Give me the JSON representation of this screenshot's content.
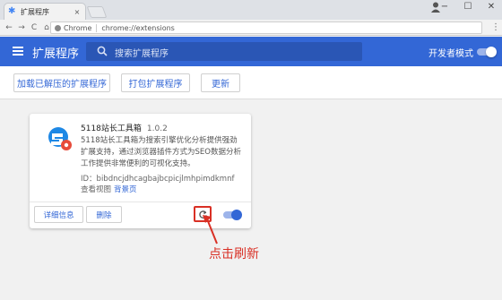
{
  "browser": {
    "tab_title": "扩展程序",
    "tab_close": "×",
    "window_controls": [
      "−",
      "☐",
      "✕"
    ],
    "nav": [
      "←",
      "→",
      "C",
      "⌂"
    ],
    "omnibox": {
      "chip_label": "Chrome",
      "url": "chrome://extensions"
    },
    "star_icon": "☆",
    "menu_icon": "⋮"
  },
  "header": {
    "title": "扩展程序",
    "search_placeholder": "搜索扩展程序",
    "developer_mode_label": "开发者模式",
    "developer_mode_enabled": true,
    "accent_color": "#3367d6"
  },
  "actions": {
    "load_unpacked": "加载已解压的扩展程序",
    "pack_extension": "打包扩展程序",
    "update": "更新"
  },
  "extension": {
    "name": "5118站长工具箱",
    "version": "1.0.2",
    "description": "5118站长工具箱为搜索引擎优化分析提供强劲扩展支持，通过浏览器插件方式为SEO数据分析工作提供非常便利的可视化支持。",
    "id_label": "ID：bibdncjdhcagbajbcpicjlmhpimdkmnf",
    "views_label": "查看视图",
    "views_link": "背景页",
    "details_button": "详细信息",
    "remove_button": "删除",
    "enabled": true
  },
  "annotation": {
    "text": "点击刷新",
    "color": "#d93025"
  }
}
